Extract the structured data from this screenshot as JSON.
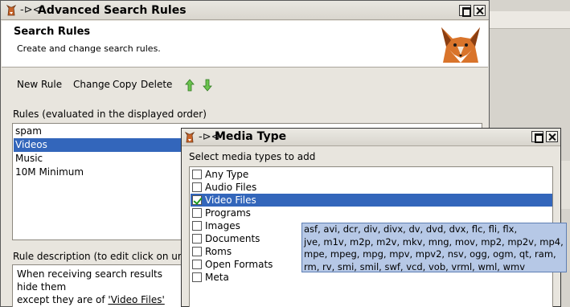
{
  "main_window": {
    "title": "Advanced Search Rules",
    "header_title": "Search Rules",
    "header_subtitle": "Create and change search rules.",
    "toolbar": {
      "new_rule": "New Rule",
      "change": "Change",
      "copy": "Copy",
      "delete": "Delete"
    },
    "rules_label": "Rules (evaluated in the displayed order)",
    "rules": [
      "spam",
      "Videos",
      "Music",
      "10M Minimum"
    ],
    "selected_rule": "Videos",
    "description_label": "Rule description (to edit click on und",
    "description": {
      "line1": "When receiving search results",
      "line2": "hide them",
      "line3_prefix": "except they are of ",
      "line3_link": "'Video Files'"
    }
  },
  "media_dialog": {
    "title": "Media Type",
    "label": "Select media types to add",
    "items": [
      {
        "label": "Any Type",
        "checked": false
      },
      {
        "label": "Audio Files",
        "checked": false
      },
      {
        "label": "Video Files",
        "checked": true
      },
      {
        "label": "Programs",
        "checked": false
      },
      {
        "label": "Images",
        "checked": false
      },
      {
        "label": "Documents",
        "checked": false
      },
      {
        "label": "Roms",
        "checked": false
      },
      {
        "label": "Open Formats",
        "checked": false
      },
      {
        "label": "Meta",
        "checked": false
      }
    ],
    "selected_item": "Video Files"
  },
  "tooltip": {
    "line1": "asf, avi, dcr, div, divx, dv, dvd, dvx, flc, fli, flx,",
    "line2": "jve, m1v, m2p, m2v, mkv, mng, mov, mp2, mp2v, mp4,",
    "line3": "mpe, mpeg, mpg, mpv, mpv2, nsv, ogg, ogm, qt, ram,",
    "line4": "rm, rv, smi, smil, swf, vcd, vob, vrml, wml, wmv"
  },
  "colors": {
    "selection": "#3366bb",
    "tooltip_bg": "#b6c8e6",
    "arrow_green": "#4caf3a",
    "checkmark": "#1d9a1d"
  },
  "icons": [
    "app-icon",
    "pin-icon",
    "maximize-icon",
    "close-icon",
    "fox-logo",
    "arrow-up-icon",
    "arrow-down-icon",
    "checkbox-icon"
  ]
}
